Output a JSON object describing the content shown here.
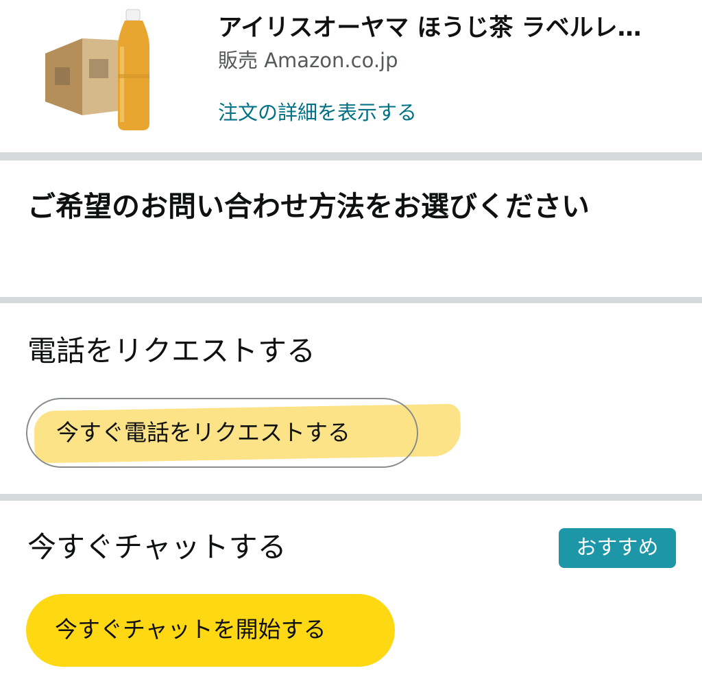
{
  "product": {
    "title": "アイリスオーヤマ ほうじ茶 ラベルレ…",
    "seller": "販売 Amazon.co.jp",
    "details_link": "注文の詳細を表示する"
  },
  "contact": {
    "heading": "ご希望のお問い合わせ方法をお選びください",
    "phone": {
      "title": "電話をリクエストする",
      "button": "今すぐ電話をリクエストする"
    },
    "chat": {
      "title": "今すぐチャットする",
      "badge": "おすすめ",
      "button": "今すぐチャットを開始する"
    }
  },
  "colors": {
    "link": "#007185",
    "badge": "#1d97a8",
    "primary_button": "#ffd814",
    "highlight_marker": "#fde07a",
    "divider": "#d5dbdb"
  }
}
